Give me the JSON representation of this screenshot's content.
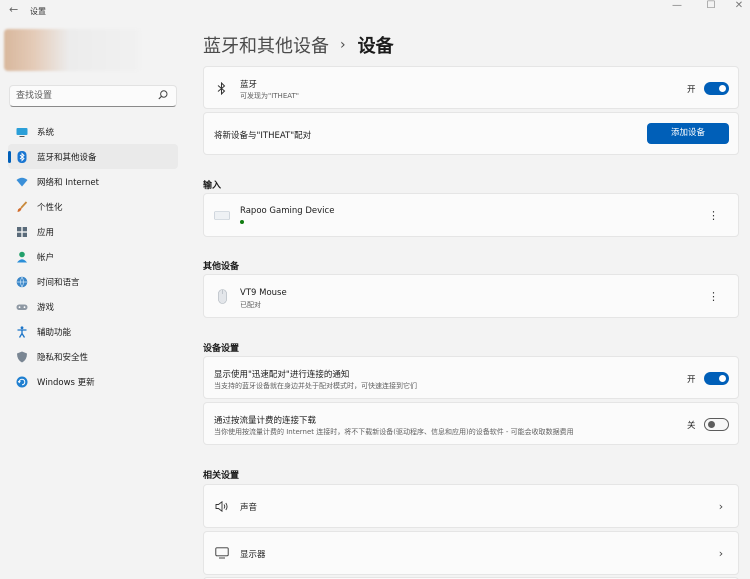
{
  "window": {
    "title": "设置",
    "back_icon": "←",
    "minimize_icon": "—",
    "maximize_icon": "☐",
    "close_icon": "✕"
  },
  "search": {
    "placeholder": "查找设置"
  },
  "sidebar": {
    "items": [
      {
        "label": "系统",
        "icon": "display-icon"
      },
      {
        "label": "蓝牙和其他设备",
        "icon": "bluetooth-icon",
        "selected": true
      },
      {
        "label": "网络和 Internet",
        "icon": "wifi-icon"
      },
      {
        "label": "个性化",
        "icon": "brush-icon"
      },
      {
        "label": "应用",
        "icon": "apps-icon"
      },
      {
        "label": "帐户",
        "icon": "person-icon"
      },
      {
        "label": "时间和语言",
        "icon": "globe-clock-icon"
      },
      {
        "label": "游戏",
        "icon": "gamepad-icon"
      },
      {
        "label": "辅助功能",
        "icon": "accessibility-icon"
      },
      {
        "label": "隐私和安全性",
        "icon": "shield-icon"
      },
      {
        "label": "Windows 更新",
        "icon": "update-icon"
      }
    ]
  },
  "breadcrumb": {
    "parent": "蓝牙和其他设备",
    "separator": "›",
    "current": "设备"
  },
  "bluetooth": {
    "title": "蓝牙",
    "subtitle": "可发现为\"ITHEAT\"",
    "toggle_label": "开",
    "on": true
  },
  "pair": {
    "text": "将新设备与\"ITHEAT\"配对",
    "button": "添加设备"
  },
  "input_section": {
    "heading": "输入",
    "device": {
      "name": "Rapoo Gaming Device",
      "status_color": "#107c10"
    }
  },
  "other_section": {
    "heading": "其他设备",
    "device": {
      "name": "VT9 Mouse",
      "status": "已配对"
    }
  },
  "device_settings": {
    "heading": "设备设置",
    "swift_pair": {
      "title": "显示使用\"迅速配对\"进行连接的通知",
      "subtitle": "当支持的蓝牙设备就在身边并处于配对模式时，可快速连接到它们",
      "toggle_label": "开",
      "on": true
    },
    "metered": {
      "title": "通过按流量计费的连接下载",
      "subtitle": "当你使用按流量计费的 Internet 连接时，将不下载新设备(驱动程序、信息和应用)的设备软件 - 可能会收取数据费用",
      "toggle_label": "关",
      "on": false
    }
  },
  "related": {
    "heading": "相关设置",
    "items": [
      {
        "label": "声音",
        "icon": "speaker-icon"
      },
      {
        "label": "显示器",
        "icon": "monitor-icon"
      }
    ]
  },
  "colors": {
    "accent": "#005fb8",
    "background": "#f3f3f3",
    "card": "#fbfbfb"
  }
}
